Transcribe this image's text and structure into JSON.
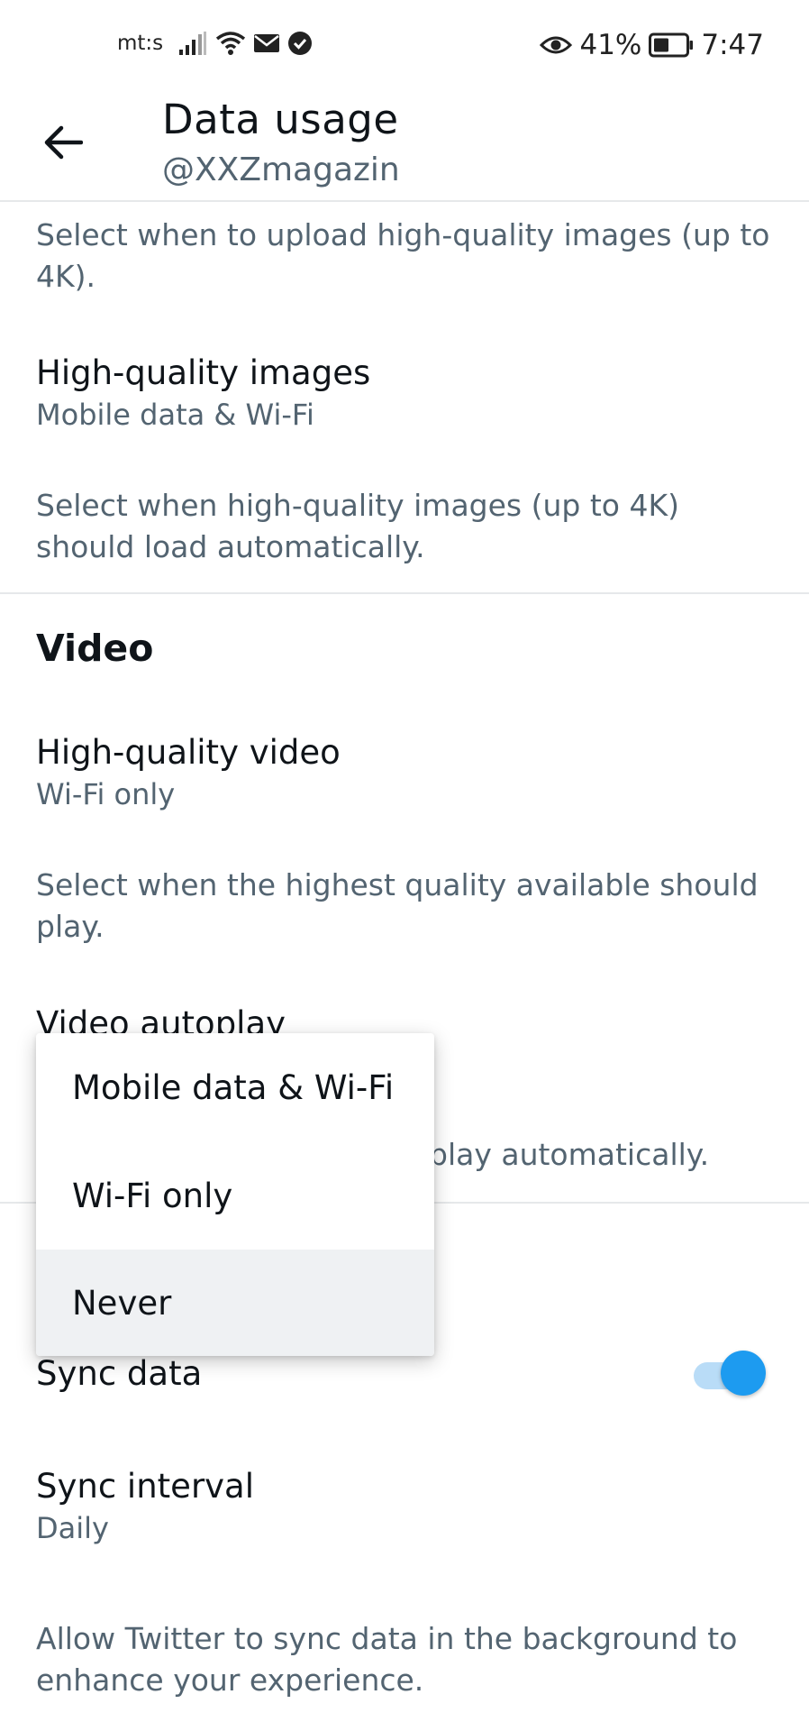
{
  "status_bar": {
    "carrier": "mt:s",
    "battery": "41%",
    "time": "7:47",
    "icons": [
      "signal-icon",
      "wifi-icon",
      "mail-icon",
      "check-circle-icon",
      "eye-icon",
      "battery-icon"
    ]
  },
  "app_bar": {
    "back_icon": "arrow-left-icon",
    "title": "Data usage",
    "subtitle": "@XXZmagazin"
  },
  "images": {
    "upload_desc": "Select when to upload high-quality images (up to 4K).",
    "hq_images_label": "High-quality images",
    "hq_images_value": "Mobile data & Wi-Fi",
    "hq_images_desc": "Select when high-quality images (up to 4K) should load automatically."
  },
  "video": {
    "header": "Video",
    "hq_video_label": "High-quality video",
    "hq_video_value": "Wi-Fi only",
    "hq_video_desc": "Select when the highest quality available should play.",
    "autoplay_label": "Video autoplay",
    "autoplay_desc_visible": "play automatically."
  },
  "sync": {
    "sync_data_label": "Sync data",
    "sync_data_enabled": true,
    "sync_interval_label": "Sync interval",
    "sync_interval_value": "Daily",
    "sync_desc": "Allow Twitter to sync data in the background to enhance your experience."
  },
  "popup_menu": {
    "options": [
      "Mobile data & Wi-Fi",
      "Wi-Fi only",
      "Never"
    ],
    "highlighted": "Never"
  },
  "colors": {
    "accent": "#1d9bf0",
    "accent_track": "#b9dcf7",
    "secondary_text": "#536471",
    "primary_text": "#0f1419",
    "divider": "#e6e8ea",
    "menu_highlight": "#eff1f3"
  }
}
